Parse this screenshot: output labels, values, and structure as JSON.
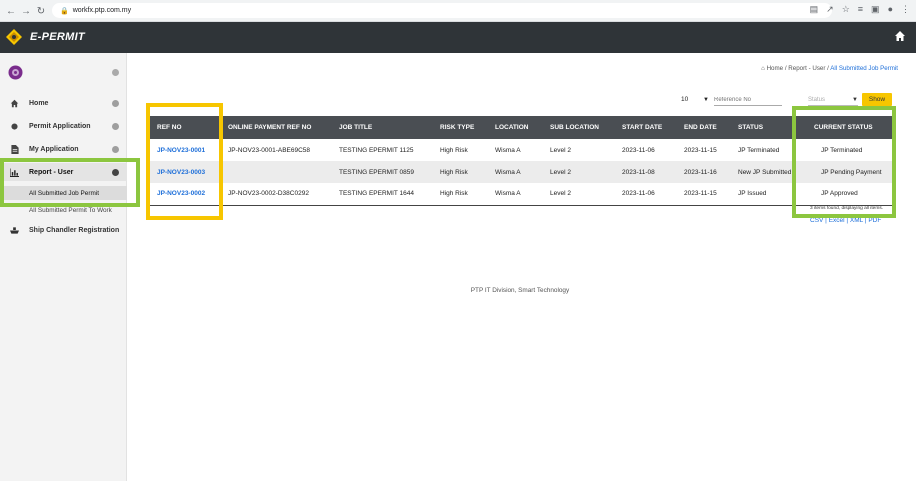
{
  "browser": {
    "url": "workfx.ptp.com.my",
    "back_icon": "back-arrow-icon",
    "forward_icon": "forward-arrow-icon",
    "reload_icon": "reload-icon"
  },
  "app": {
    "title": "E-PERMIT",
    "accent_color": "#f7c600",
    "header_color": "#2f3438"
  },
  "sidebar": {
    "items": [
      {
        "label": "Home",
        "icon": "home-icon"
      },
      {
        "label": "Permit Application",
        "icon": "circle-icon"
      },
      {
        "label": "My Application",
        "icon": "document-icon"
      },
      {
        "label": "Report - User",
        "icon": "chart-icon"
      },
      {
        "label": "Ship Chandler Registration",
        "icon": "ship-icon"
      }
    ],
    "subitems": [
      {
        "label": "All Submitted Job Permit"
      },
      {
        "label": "All Submitted Permit To Work"
      }
    ]
  },
  "breadcrumb": {
    "home": "Home",
    "sep1": " /  ",
    "report": "Report - User",
    "sep2": " /  ",
    "current": "All Submitted Job Permit"
  },
  "toolbar": {
    "page_size": "10",
    "ref_placeholder": "Reference No",
    "status_placeholder": "Status",
    "show_label": "Show"
  },
  "table": {
    "headers": [
      "REF NO",
      "ONLINE PAYMENT REF NO",
      "JOB TITLE",
      "RISK TYPE",
      "LOCATION",
      "SUB LOCATION",
      "START DATE",
      "END DATE",
      "STATUS",
      "CURRENT STATUS"
    ],
    "rows": [
      {
        "ref_no": "JP-NOV23-0001",
        "payment_ref": "JP-NOV23-0001-ABE69C58",
        "job_title": "TESTING EPERMIT 1125",
        "risk_type": "High Risk",
        "location": "Wisma A",
        "sub_location": "Level 2",
        "start_date": "2023-11-06",
        "end_date": "2023-11-15",
        "status": "JP Terminated",
        "current_status": "JP Terminated"
      },
      {
        "ref_no": "JP-NOV23-0003",
        "payment_ref": "",
        "job_title": "TESTING EPERMIT 0859",
        "risk_type": "High Risk",
        "location": "Wisma A",
        "sub_location": "Level 2",
        "start_date": "2023-11-08",
        "end_date": "2023-11-16",
        "status": "New JP Submitted",
        "current_status": "JP Pending Payment"
      },
      {
        "ref_no": "JP-NOV23-0002",
        "payment_ref": "JP-NOV23-0002-D38C0292",
        "job_title": "TESTING EPERMIT 1644",
        "risk_type": "High Risk",
        "location": "Wisma A",
        "sub_location": "Level 2",
        "start_date": "2023-11-06",
        "end_date": "2023-11-15",
        "status": "JP Issued",
        "current_status": "JP Approved"
      }
    ],
    "footer_note": "3 items found, displaying all items.",
    "export": {
      "csv": "CSV",
      "sep1": " | ",
      "excel": "Excel",
      "sep2": " | ",
      "xml": "XML",
      "sep3": " | ",
      "pdf": "PDF"
    }
  },
  "page_footer": "PTP IT Division, Smart Technology",
  "annotations": {
    "yellow": "#f7c600",
    "green": "#8cc63f"
  }
}
